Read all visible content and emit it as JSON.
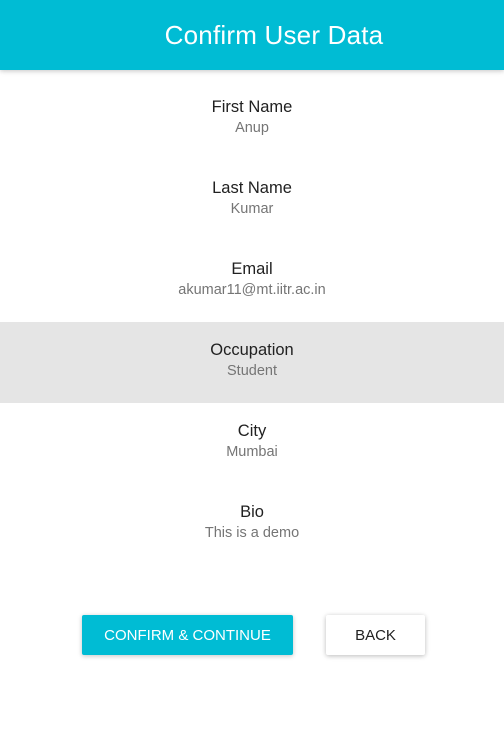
{
  "app_bar": {
    "title": "Confirm User Data",
    "background_color": "#00bcd4"
  },
  "fields": [
    {
      "label": "First Name",
      "value": "Anup"
    },
    {
      "label": "Last Name",
      "value": "Kumar"
    },
    {
      "label": "Email",
      "value": "akumar11@mt.iitr.ac.in"
    },
    {
      "label": "Occupation",
      "value": "Student",
      "highlighted": true
    },
    {
      "label": "City",
      "value": "Mumbai"
    },
    {
      "label": "Bio",
      "value": "This is a demo"
    }
  ],
  "actions": {
    "confirm_label": "CONFIRM & CONTINUE",
    "back_label": "BACK"
  },
  "colors": {
    "accent": "#00bcd4",
    "highlight_row": "#e5e5e5",
    "label_text": "#212121",
    "value_text": "#757575"
  }
}
